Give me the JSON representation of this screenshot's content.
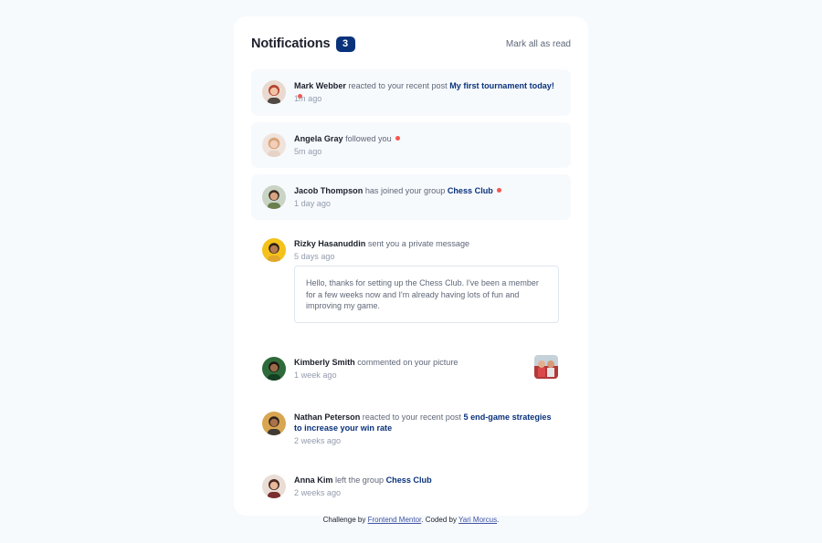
{
  "header": {
    "title": "Notifications",
    "unread_count": "3",
    "mark_all": "Mark all as read"
  },
  "notifications": [
    {
      "name": "Mark Webber",
      "action": "reacted to your recent post",
      "target": "My first tournament today!",
      "time": "1m ago",
      "unread": true
    },
    {
      "name": "Angela Gray",
      "action": "followed you",
      "target": "",
      "time": "5m ago",
      "unread": true
    },
    {
      "name": "Jacob Thompson",
      "action": "has joined your group",
      "target": "Chess Club",
      "time": "1 day ago",
      "unread": true
    },
    {
      "name": "Rizky Hasanuddin",
      "action": "sent you a private message",
      "target": "",
      "time": "5 days ago",
      "message": "Hello, thanks for setting up the Chess Club. I've been a member for a few weeks now and I'm already having lots of fun and improving my game.",
      "unread": false
    },
    {
      "name": "Kimberly Smith",
      "action": "commented on your picture",
      "target": "",
      "time": "1 week ago",
      "unread": false
    },
    {
      "name": "Nathan Peterson",
      "action": "reacted to your recent post",
      "target": "5 end-game strategies to increase your win rate",
      "time": "2 weeks ago",
      "unread": false
    },
    {
      "name": "Anna Kim",
      "action": "left the group",
      "target": "Chess Club",
      "time": "2 weeks ago",
      "unread": false
    }
  ],
  "footer": {
    "prefix": "Challenge by",
    "link1": "Frontend Mentor",
    "middle": ". Coded by",
    "link2": "Yari Morcus",
    "suffix": "."
  },
  "colors": {
    "accent": "#0a327b",
    "unread_dot": "#f65552",
    "unread_bg": "#f7fafd"
  }
}
